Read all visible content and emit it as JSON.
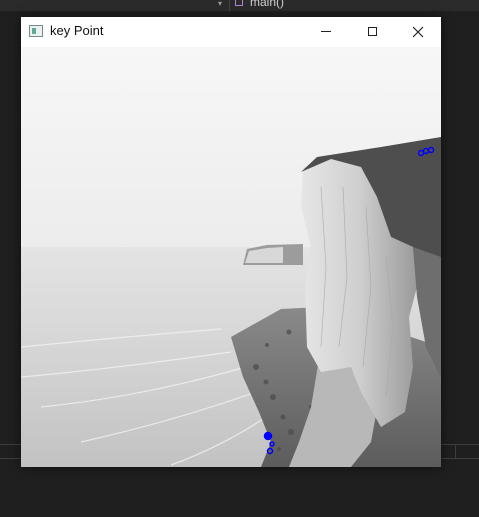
{
  "ide": {
    "dropdown_glyph": "▾",
    "function_label": "main()"
  },
  "window": {
    "title": "key Point",
    "icon": "app-window-icon",
    "controls": [
      "minimize-icon",
      "maximize-icon",
      "close-icon"
    ],
    "close_glyph": "✕"
  },
  "image": {
    "description_tag": "grayscale coastal cliff photo with keypoints",
    "keypoint_color": "#0000ff"
  }
}
